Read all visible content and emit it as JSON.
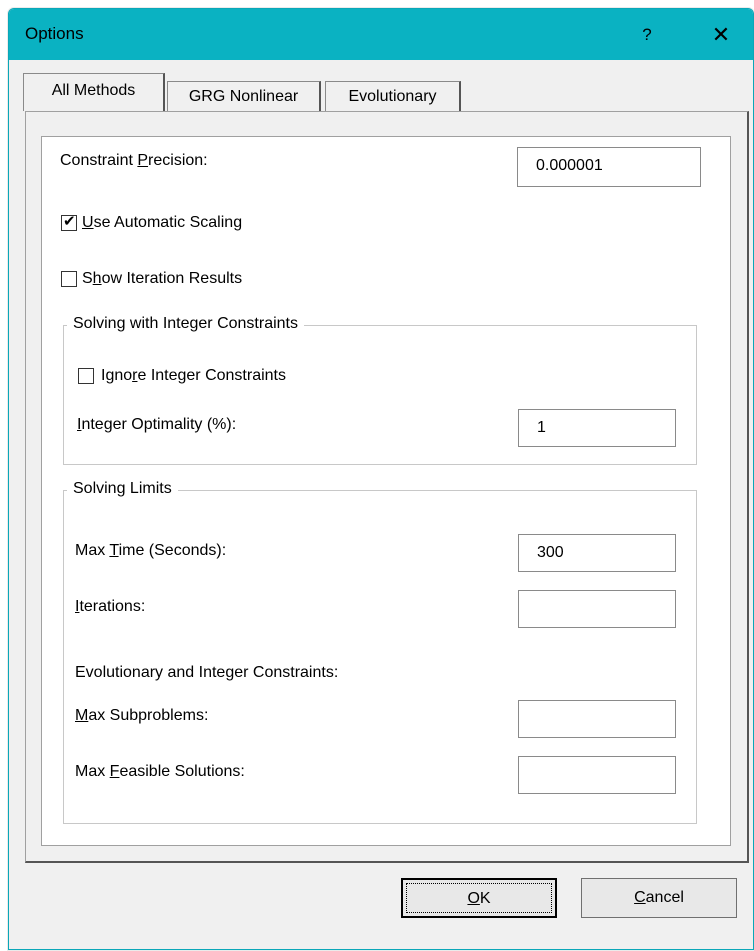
{
  "window": {
    "title": "Options",
    "help_glyph": "?",
    "close_glyph": "✕"
  },
  "tabs": [
    {
      "label": "All Methods",
      "active": true
    },
    {
      "label": "GRG Nonlinear",
      "active": false
    },
    {
      "label": "Evolutionary",
      "active": false
    }
  ],
  "all_methods": {
    "constraint_precision": {
      "label_pre": "Constraint ",
      "label_u": "P",
      "label_post": "recision:",
      "value": "0.000001"
    },
    "use_automatic_scaling": {
      "label_u": "U",
      "label_post": "se Automatic Scaling",
      "checked": true,
      "mark": "✔"
    },
    "show_iteration_results": {
      "label_pre": "S",
      "label_u": "h",
      "label_post": "ow Iteration Results",
      "checked": false
    },
    "integer_group": {
      "title": "Solving with Integer Constraints",
      "ignore_integer": {
        "label_pre": "Igno",
        "label_u": "r",
        "label_post": "e Integer Constraints",
        "checked": false
      },
      "integer_optimality": {
        "label_u": "I",
        "label_post": "nteger Optimality (%):",
        "value": "1"
      }
    },
    "limits_group": {
      "title": "Solving Limits",
      "max_time": {
        "label_pre": "Max ",
        "label_u": "T",
        "label_post": "ime (Seconds):",
        "value": "300"
      },
      "iterations": {
        "label_u": "I",
        "label_post": "terations:",
        "value": ""
      },
      "evo_heading": "Evolutionary and Integer Constraints:",
      "max_subproblems": {
        "label_u": "M",
        "label_post": "ax Subproblems:",
        "value": ""
      },
      "max_feasible": {
        "label_pre": "Max ",
        "label_u": "F",
        "label_post": "easible Solutions:",
        "value": ""
      }
    }
  },
  "buttons": {
    "ok": {
      "label_u": "O",
      "label_post": "K"
    },
    "cancel": {
      "label_u": "C",
      "label_post": "ancel"
    }
  }
}
